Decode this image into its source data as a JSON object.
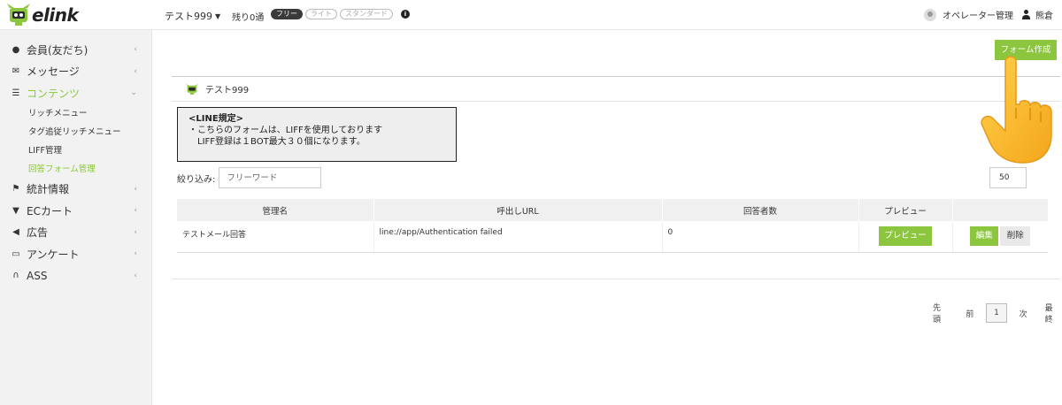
{
  "brand": {
    "logo_text": "elink",
    "green": "#8cc63f"
  },
  "header": {
    "account_name": "テスト999",
    "remaining": "残り0通",
    "plans": [
      {
        "label": "フリー",
        "active": true
      },
      {
        "label": "ライト",
        "active": false
      },
      {
        "label": "スタンダード",
        "active": false
      }
    ],
    "operator_label": "オペレーター管理",
    "user_name": "熊倉"
  },
  "sidebar": {
    "items": [
      {
        "label": "会員(友だち)",
        "icon": "user-icon"
      },
      {
        "label": "メッセージ",
        "icon": "envelope-icon"
      },
      {
        "label": "コンテンツ",
        "icon": "list-icon"
      },
      {
        "label": "統計情報",
        "icon": "flag-icon"
      },
      {
        "label": "ECカート",
        "icon": "cart-icon"
      },
      {
        "label": "広告",
        "icon": "megaphone-icon"
      },
      {
        "label": "アンケート",
        "icon": "keyboard-icon"
      },
      {
        "label": "ASS",
        "icon": "headset-icon"
      }
    ],
    "sub_items": [
      {
        "label": "リッチメニュー"
      },
      {
        "label": "タグ追従リッチメニュー"
      },
      {
        "label": "LIFF管理"
      },
      {
        "label": "回答フォーム管理"
      }
    ]
  },
  "main": {
    "create_button": "フォーム作成",
    "panel_title": "テスト999",
    "notice": {
      "title": "<LINE規定>",
      "line1": "・こちらのフォームは、LIFFを使用しております",
      "line2": "LIFF登録は１BOT最大３０個になります。"
    },
    "filter": {
      "label": "絞り込み:",
      "placeholder": "フリーワード"
    },
    "per_page": "50",
    "table": {
      "columns": [
        "管理名",
        "呼出しURL",
        "回答者数",
        "プレビュー",
        ""
      ],
      "rows": [
        {
          "name": "テストメール回答",
          "url": "line://app/Authentication failed",
          "count": "0",
          "preview_label": "プレビュー",
          "edit_label": "編集",
          "delete_label": "削除"
        }
      ]
    },
    "pagination": {
      "first": "先頭",
      "prev": "前",
      "current": "1",
      "next": "次",
      "last": "最終"
    }
  }
}
